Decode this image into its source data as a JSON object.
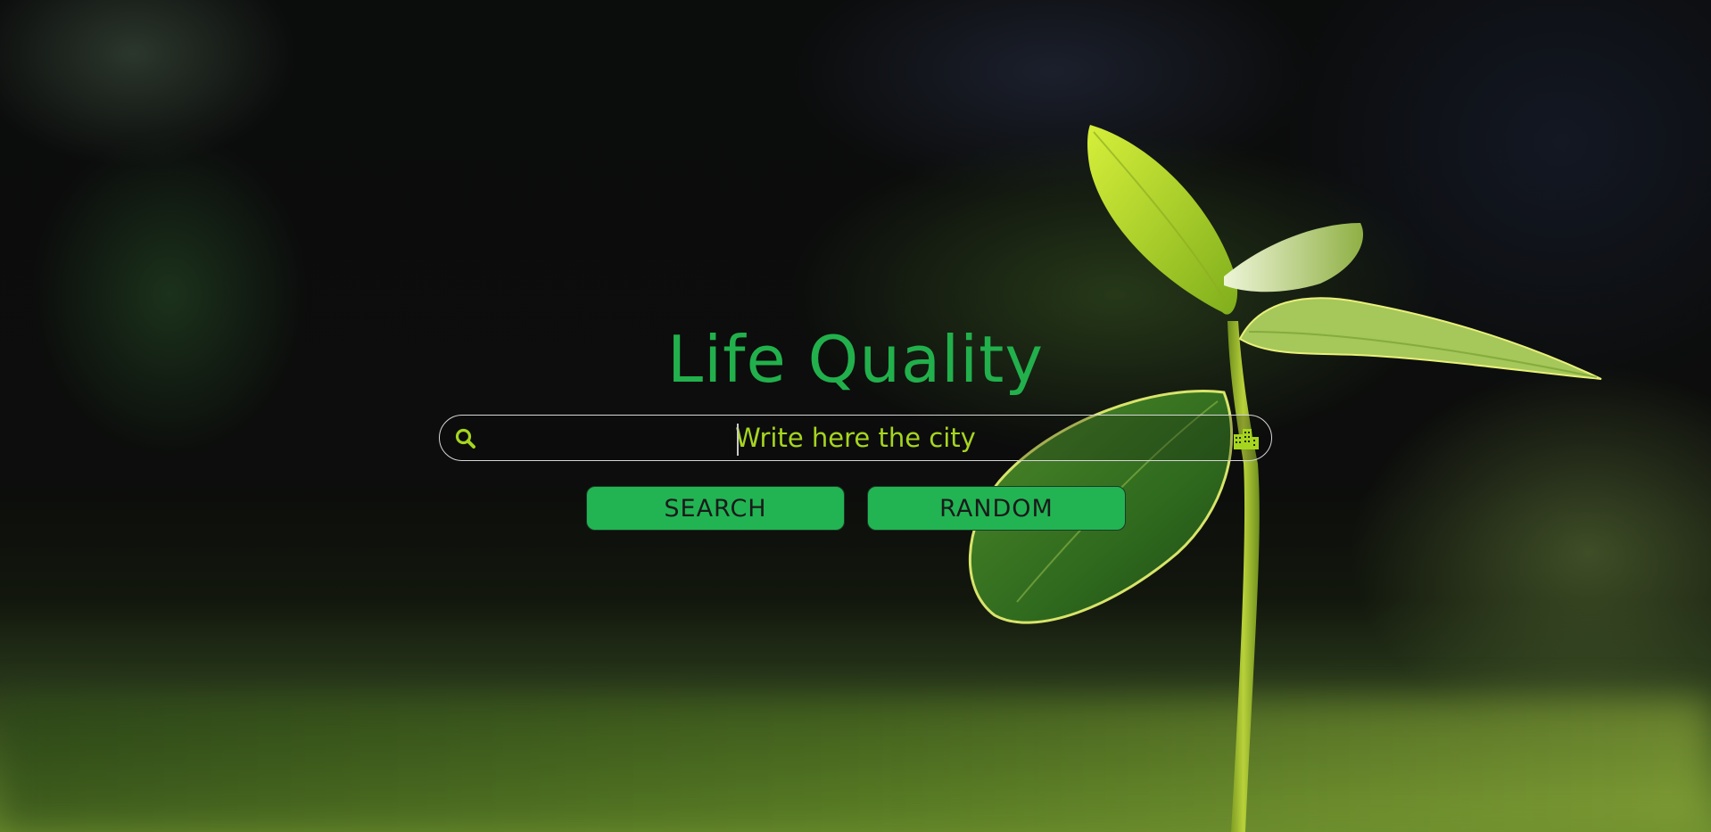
{
  "hero": {
    "title": "Life Quality"
  },
  "search": {
    "placeholder": "Write here the city",
    "value": "",
    "leading_icon": "search-icon",
    "trailing_icon": "building-icon"
  },
  "actions": {
    "search_label": "SEARCH",
    "random_label": "RANDOM"
  },
  "colors": {
    "accent_green": "#22b04c",
    "button_green": "#22b453",
    "input_text": "#a6d51f",
    "icon_lime": "#a6d51f"
  }
}
